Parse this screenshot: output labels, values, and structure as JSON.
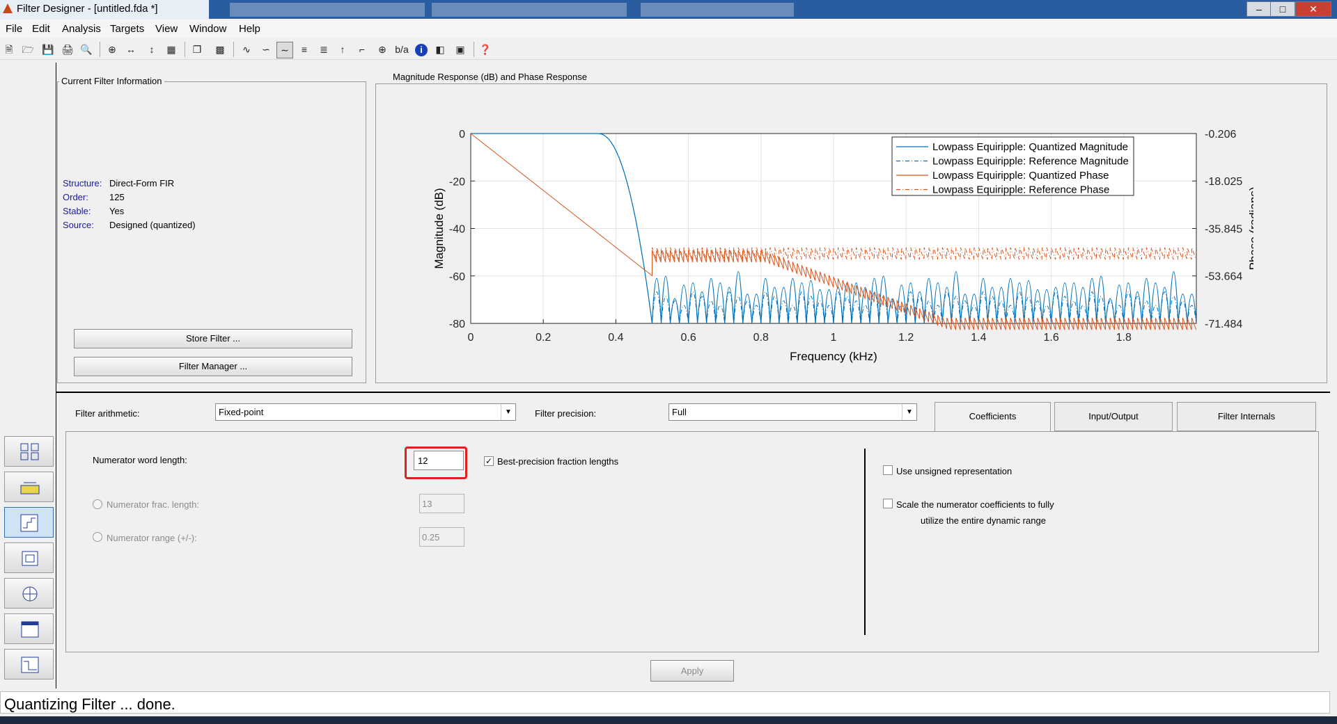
{
  "window": {
    "title": "Filter Designer - [untitled.fda *]"
  },
  "menu": [
    "File",
    "Edit",
    "Analysis",
    "Targets",
    "View",
    "Window",
    "Help"
  ],
  "current_filter": {
    "heading": "Current Filter Information",
    "rows": [
      {
        "key": "Structure:",
        "value": "Direct-Form FIR"
      },
      {
        "key": "Order:",
        "value": "125"
      },
      {
        "key": "Stable:",
        "value": "Yes"
      },
      {
        "key": "Source:",
        "value": "Designed (quantized)"
      }
    ],
    "store_button": "Store Filter ...",
    "manager_button": "Filter Manager ..."
  },
  "plot": {
    "heading": "Magnitude Response (dB) and Phase Response",
    "chart_data": {
      "type": "line",
      "xlabel": "Frequency (kHz)",
      "ylabel": "Magnitude (dB)",
      "y2label": "Phase (radians)",
      "xlim": [
        0,
        2
      ],
      "ylim": [
        -80,
        0
      ],
      "y2lim": [
        -71.484,
        -0.206
      ],
      "x_ticks": [
        "0",
        "0.2",
        "0.4",
        "0.6",
        "0.8",
        "1",
        "1.2",
        "1.4",
        "1.6",
        "1.8"
      ],
      "y_ticks": [
        "0",
        "-20",
        "-40",
        "-60",
        "-80"
      ],
      "y2_ticks": [
        "-0.206",
        "-18.025",
        "-35.845",
        "-53.664",
        "-71.484"
      ],
      "legend_position": "top-right",
      "series": [
        {
          "name": "Lowpass Equiripple: Quantized Magnitude",
          "color": "#0072bd",
          "style": "solid"
        },
        {
          "name": "Lowpass Equiripple: Reference Magnitude",
          "color": "#0072bd",
          "style": "dashdot"
        },
        {
          "name": "Lowpass Equiripple: Quantized Phase",
          "color": "#d95319",
          "style": "solid"
        },
        {
          "name": "Lowpass Equiripple: Reference Phase",
          "color": "#d95319",
          "style": "dashdot"
        }
      ],
      "magnitude_passband_edge": 0.4,
      "magnitude_stopband_edge": 0.5,
      "stopband_peaks_db": [
        -60,
        -57,
        -65,
        -63,
        -60,
        -62,
        -60,
        -60
      ],
      "phase_points": [
        [
          0,
          -0.206
        ],
        [
          0.5,
          -53.6
        ],
        [
          0.6,
          -46
        ],
        [
          0.8,
          -46
        ],
        [
          1.1,
          -57
        ],
        [
          1.3,
          -71.4
        ],
        [
          2.0,
          -71.4
        ]
      ],
      "reference_phase_level": -45
    }
  },
  "bottom": {
    "arith_label": "Filter arithmetic:",
    "arith_value": "Fixed-point",
    "precision_label": "Filter precision:",
    "precision_value": "Full",
    "tabs": [
      "Coefficients",
      "Input/Output",
      "Filter Internals"
    ],
    "num_word_label": "Numerator word length:",
    "num_word_value": "12",
    "best_precision": "Best-precision fraction lengths",
    "num_frac_label": "Numerator frac. length:",
    "num_frac_value": "13",
    "num_range_label": "Numerator range (+/-):",
    "num_range_value": "0.25",
    "unsigned_label": "Use unsigned representation",
    "scale_label_1": "Scale the numerator coefficients to fully",
    "scale_label_2": "utilize the entire dynamic range",
    "apply": "Apply"
  },
  "status": "Quantizing Filter ... done.",
  "colors": {
    "highlight": "#e0201b",
    "selected_side": "#2f6db2"
  }
}
